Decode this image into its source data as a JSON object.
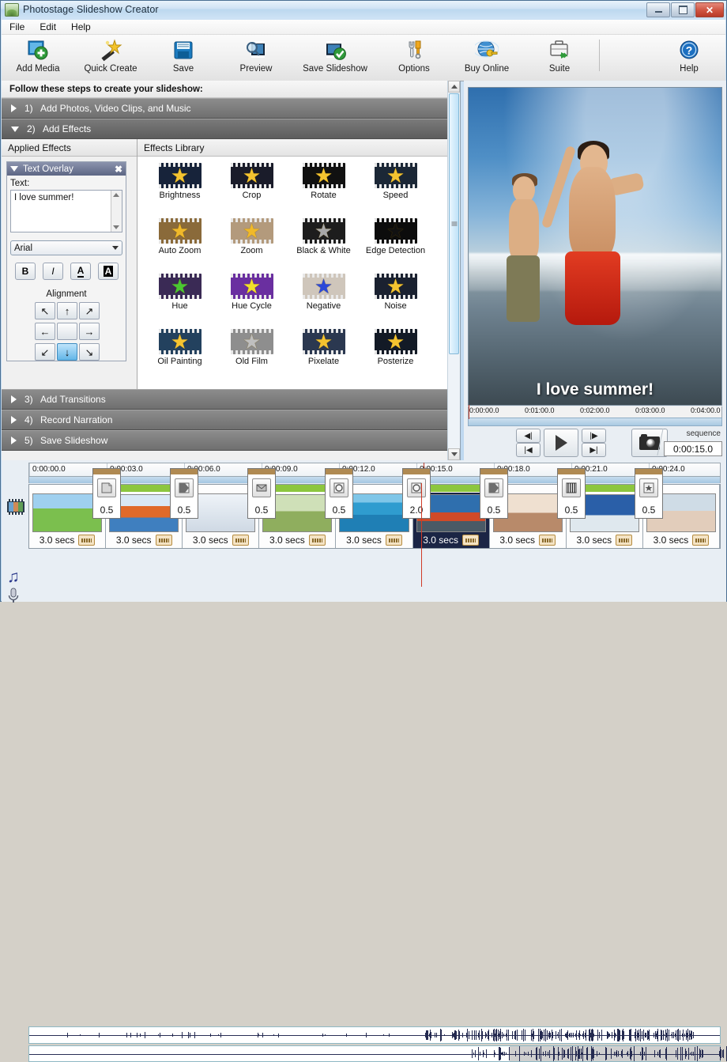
{
  "window": {
    "title": "Photostage Slideshow Creator",
    "buttons": {
      "minimize": "_",
      "maximize": "□",
      "close": "✕"
    }
  },
  "menu": {
    "items": [
      "File",
      "Edit",
      "Help"
    ]
  },
  "toolbar": {
    "items": [
      {
        "label": "Add Media",
        "icon": "add-media-icon"
      },
      {
        "label": "Quick Create",
        "icon": "magic-wand-icon"
      },
      {
        "label": "Save",
        "icon": "floppy-disk-icon"
      },
      {
        "label": "Preview",
        "icon": "magnifier-film-icon"
      },
      {
        "label": "Save Slideshow",
        "icon": "film-check-icon"
      },
      {
        "label": "Options",
        "icon": "tools-icon"
      },
      {
        "label": "Buy Online",
        "icon": "globe-key-icon"
      },
      {
        "label": "Suite",
        "icon": "briefcase-icon"
      }
    ],
    "help": {
      "label": "Help",
      "icon": "help-question-icon"
    }
  },
  "instructions": "Follow these steps to create your slideshow:",
  "steps": [
    {
      "num": "1)",
      "label": "Add Photos, Video Clips, and Music",
      "expanded": false
    },
    {
      "num": "2)",
      "label": "Add Effects",
      "expanded": true
    },
    {
      "num": "3)",
      "label": "Add Transitions",
      "expanded": false
    },
    {
      "num": "4)",
      "label": "Record Narration",
      "expanded": false
    },
    {
      "num": "5)",
      "label": "Save Slideshow",
      "expanded": false
    }
  ],
  "applied_effects": {
    "header": "Applied Effects",
    "overlay": {
      "title": "Text Overlay",
      "close": "✖",
      "text_label": "Text:",
      "text_value": "I love summer!",
      "font": "Arial",
      "format_buttons": [
        {
          "name": "bold-button",
          "glyph": "B"
        },
        {
          "name": "italic-button",
          "glyph": "I"
        },
        {
          "name": "text-color-button",
          "glyph": "A"
        },
        {
          "name": "text-background-button",
          "glyph": "A"
        }
      ],
      "alignment_label": "Alignment",
      "alignment_buttons": [
        {
          "name": "align-top-left",
          "glyph": "↖",
          "selected": false
        },
        {
          "name": "align-top-center",
          "glyph": "↑",
          "selected": false
        },
        {
          "name": "align-top-right",
          "glyph": "↗",
          "selected": false
        },
        {
          "name": "align-middle-left",
          "glyph": "←",
          "selected": false
        },
        {
          "name": "align-middle-center",
          "glyph": "",
          "selected": false
        },
        {
          "name": "align-middle-right",
          "glyph": "→",
          "selected": false
        },
        {
          "name": "align-bottom-left",
          "glyph": "↙",
          "selected": false
        },
        {
          "name": "align-bottom-center",
          "glyph": "↓",
          "selected": true
        },
        {
          "name": "align-bottom-right",
          "glyph": "↘",
          "selected": false
        }
      ]
    }
  },
  "effects_library": {
    "header": "Effects Library",
    "items": [
      {
        "label": "Brightness",
        "star": "#f5c430",
        "bg": "#17233a"
      },
      {
        "label": "Crop",
        "star": "#f5c430",
        "bg": "#1a1c2a"
      },
      {
        "label": "Rotate",
        "star": "#f5c430",
        "bg": "#111111"
      },
      {
        "label": "Speed",
        "star": "#f5c430",
        "bg": "#1b2736"
      },
      {
        "label": "Auto Zoom",
        "star": "#f0b92a",
        "bg": "#8a6a3a"
      },
      {
        "label": "Zoom",
        "star": "#f0b92a",
        "bg": "#b39a7c"
      },
      {
        "label": "Black & White",
        "star": "#a8a8a8",
        "bg": "#1d1d1d"
      },
      {
        "label": "Edge Detection",
        "star": "#111111",
        "bg": "#0c0c0c"
      },
      {
        "label": "Hue",
        "star": "#49c832",
        "bg": "#3a2a55"
      },
      {
        "label": "Hue Cycle",
        "star": "#f2e02a",
        "bg": "#6a2fa0"
      },
      {
        "label": "Negative",
        "star": "#2a48d8",
        "bg": "#cfc6bb"
      },
      {
        "label": "Noise",
        "star": "#f5c430",
        "bg": "#1a2130"
      },
      {
        "label": "Oil Painting",
        "star": "#f5c430",
        "bg": "#23415e"
      },
      {
        "label": "Old Film",
        "star": "#bfbfbf",
        "bg": "#8e8e8e"
      },
      {
        "label": "Pixelate",
        "star": "#f5c430",
        "bg": "#2b3850"
      },
      {
        "label": "Posterize",
        "star": "#f5c430",
        "bg": "#131a26"
      }
    ]
  },
  "preview": {
    "caption": "I love summer!",
    "ruler_ticks": [
      "0:00:00.0",
      "0:01:00.0",
      "0:02:00.0",
      "0:03:00.0",
      "0:04:00.0"
    ],
    "controls": [
      {
        "name": "step-back-button",
        "glyph": "◀|"
      },
      {
        "name": "play-button",
        "glyph": "▶"
      },
      {
        "name": "step-forward-button",
        "glyph": "|▶"
      },
      {
        "name": "go-to-start-button",
        "glyph": "|◀"
      },
      {
        "name": "go-to-end-button",
        "glyph": "▶|"
      },
      {
        "name": "snapshot-button",
        "glyph": "camera"
      }
    ],
    "sequence_label": "sequence",
    "sequence_time": "0:00:15.0"
  },
  "timeline": {
    "ruler_ticks": [
      "0:00:00.0",
      "0:00:03.0",
      "0:00:06.0",
      "0:00:09.0",
      "0:00:12.0",
      "0:00:15.0",
      "0:00:18.0",
      "0:00:21.0",
      "0:00:24.0"
    ],
    "playhead_time": "0:00:15.0",
    "clips": [
      {
        "duration": "3.0 secs",
        "selected": false,
        "green_bar": false,
        "thumb": "family-park-photo"
      },
      {
        "duration": "3.0 secs",
        "selected": false,
        "green_bar": true,
        "thumb": "kids-group-photo"
      },
      {
        "duration": "3.0 secs",
        "selected": false,
        "green_bar": false,
        "thumb": "family-faces-photo"
      },
      {
        "duration": "3.0 secs",
        "selected": false,
        "green_bar": true,
        "thumb": "woman-field-photo"
      },
      {
        "duration": "3.0 secs",
        "selected": false,
        "green_bar": false,
        "thumb": "snorkel-beach-photo"
      },
      {
        "duration": "3.0 secs",
        "selected": true,
        "green_bar": true,
        "thumb": "boy-summer-photo"
      },
      {
        "duration": "3.0 secs",
        "selected": false,
        "green_bar": false,
        "thumb": "family-laughing-photo"
      },
      {
        "duration": "3.0 secs",
        "selected": false,
        "green_bar": true,
        "thumb": "couple-beach-photo"
      },
      {
        "duration": "3.0 secs",
        "selected": false,
        "green_bar": false,
        "thumb": "friends-running-photo"
      }
    ],
    "transitions": [
      {
        "value": "0.5",
        "icon": "page-peel-icon"
      },
      {
        "value": "0.5",
        "icon": "wipe-icon"
      },
      {
        "value": "0.5",
        "icon": "envelope-icon"
      },
      {
        "value": "0.5",
        "icon": "circle-reveal-icon"
      },
      {
        "value": "2.0",
        "icon": "circle-reveal-icon"
      },
      {
        "value": "0.5",
        "icon": "wipe-icon"
      },
      {
        "value": "0.5",
        "icon": "blinds-icon"
      },
      {
        "value": "0.5",
        "icon": "star-icon"
      }
    ],
    "track_icons": [
      {
        "name": "video-track-icon"
      },
      {
        "name": "music-track-icon",
        "glyph": "♫"
      },
      {
        "name": "narration-track-icon",
        "glyph": "🎤"
      }
    ]
  },
  "colors": {
    "accent_green": "#8cc63f",
    "playhead_red": "#d03a26",
    "selected_blue": "#63b6e8",
    "step_gray": "#7a7a7a"
  }
}
